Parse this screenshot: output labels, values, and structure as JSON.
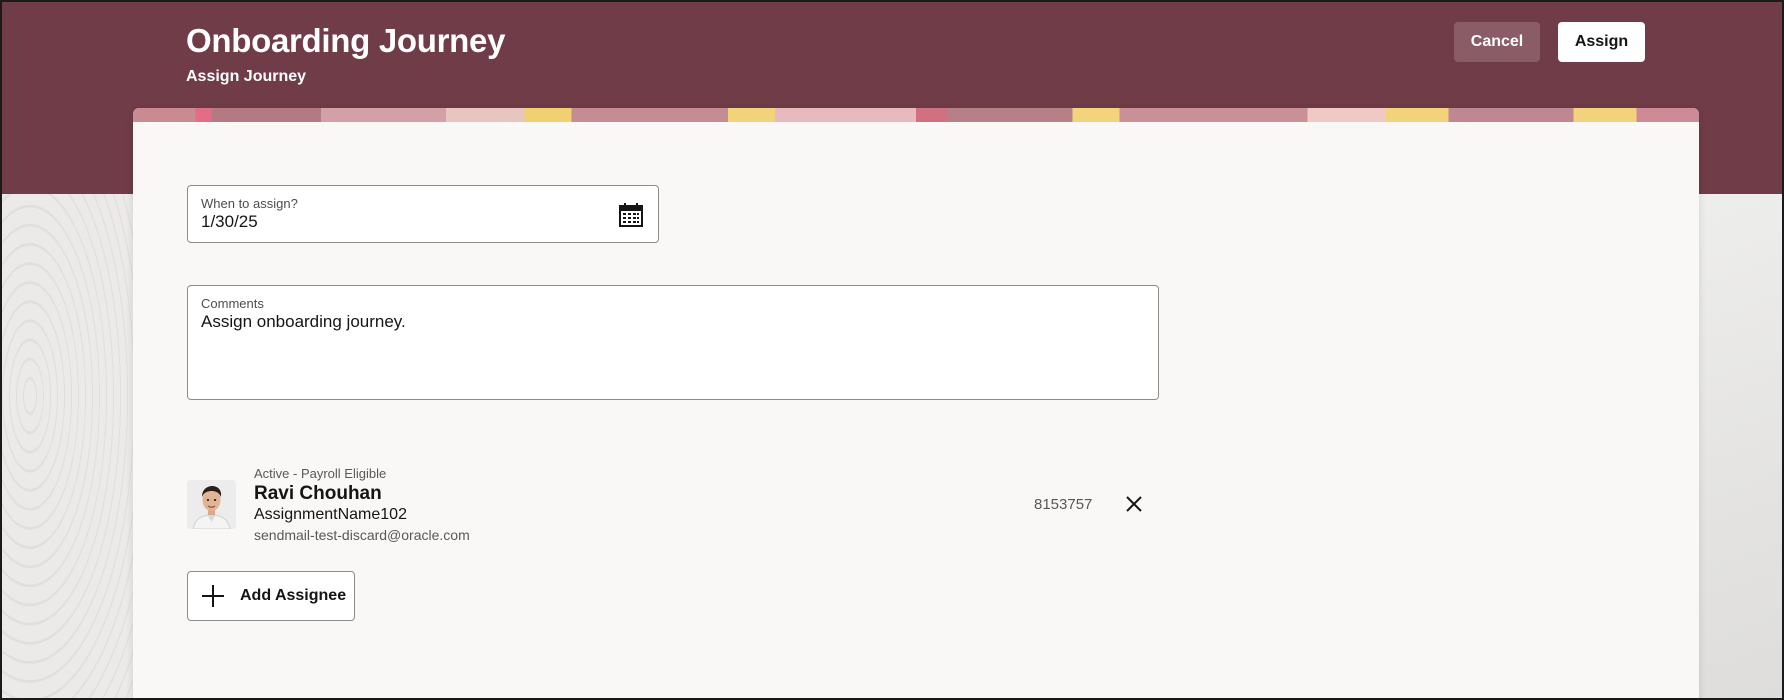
{
  "header": {
    "title": "Onboarding Journey",
    "subtitle": "Assign Journey",
    "cancel_label": "Cancel",
    "assign_label": "Assign"
  },
  "form": {
    "date": {
      "label": "When to assign?",
      "value": "1/30/25",
      "icon": "calendar-icon"
    },
    "comments": {
      "label": "Comments",
      "value": "Assign onboarding journey."
    }
  },
  "assignee": {
    "status": "Active - Payroll Eligible",
    "name": "Ravi Chouhan",
    "assignment": "AssignmentName102",
    "email": "sendmail-test-discard@oracle.com",
    "number": "8153757"
  },
  "add_assignee_label": "Add Assignee",
  "colors": {
    "header_band": "#6f3c47",
    "cancel_button": "#8a5c65",
    "card_background": "#f9f8f6"
  }
}
